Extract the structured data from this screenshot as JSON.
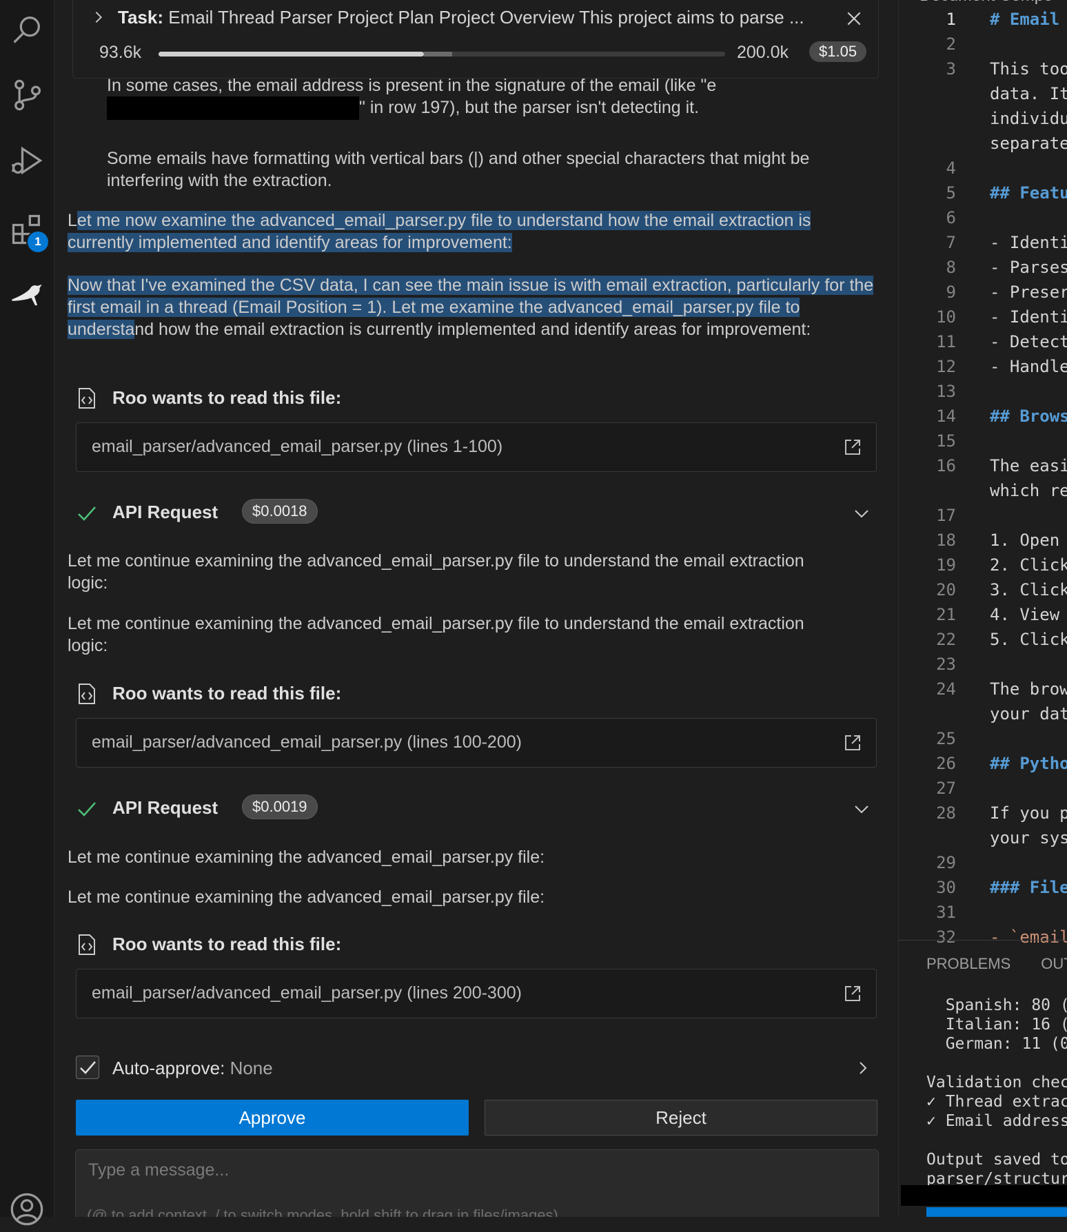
{
  "task": {
    "label": "Task:",
    "title": "Email Thread Parser Project Plan Project Overview This project aims to parse ...",
    "tokens_used": "93.6k",
    "tokens_max": "200.0k",
    "cost": "$1.05",
    "context_fraction": 0.468,
    "context_cached_fraction": 0.05
  },
  "activity": {
    "extensions_badge": "1"
  },
  "messages": {
    "p1_line1": "In some cases, the email address is present in the signature of the email (like \"e",
    "p1_line2": "\" in row 197), but the parser isn't detecting it.",
    "p2": "Some emails have formatting with vertical bars (|) and other special characters that might be interfering with the extraction.",
    "p3a": "L",
    "p3b": "et me now examine the advanced_email_parser.py file to understand how the email extraction is currently implemented and identify areas for improvement:",
    "p4a": "Now that I've examined the CSV data, I can see the main issue is with email extraction, particularly for the first email in a thread (Email Position = 1). Let me examine the advanced_email_parser.py file to understa",
    "p4b": "nd how the email extraction is currently implemented and identify areas for improvement:",
    "read_label_1": "Roo wants to read this file:",
    "file_1": "email_parser/advanced_email_parser.py (lines 1-100)",
    "api_label_1": "API Request",
    "api_cost_1": "$0.0018",
    "p5": "Let me continue examining the advanced_email_parser.py file to understand the email extraction logic:",
    "p6": "Let me continue examining the advanced_email_parser.py file to understand the email extraction logic:",
    "read_label_2": "Roo wants to read this file:",
    "file_2": "email_parser/advanced_email_parser.py (lines 100-200)",
    "api_label_2": "API Request",
    "api_cost_2": "$0.0019",
    "p7": "Let me continue examining the advanced_email_parser.py file:",
    "p8": "Let me continue examining the advanced_email_parser.py file:",
    "read_label_3": "Roo wants to read this file:",
    "file_3": "email_parser/advanced_email_parser.py (lines 200-300)"
  },
  "auto_approve": {
    "label": "Auto-approve:",
    "value": "None"
  },
  "buttons": {
    "approve": "Approve",
    "reject": "Reject"
  },
  "input": {
    "placeholder": "Type a message...",
    "hint": "(@ to add context, / to switch modes, hold shift to drag in files/images)"
  },
  "editor": {
    "top_text": "Document Compo",
    "lines": [
      {
        "n": "1",
        "text": "# Email",
        "kind": "head"
      },
      {
        "n": "2",
        "text": "",
        "kind": "text"
      },
      {
        "n": "3",
        "text": "This too",
        "kind": "text"
      },
      {
        "n": "",
        "text": "data. It",
        "kind": "text"
      },
      {
        "n": "",
        "text": "individu",
        "kind": "text"
      },
      {
        "n": "",
        "text": "separate",
        "kind": "text"
      },
      {
        "n": "4",
        "text": "",
        "kind": "text"
      },
      {
        "n": "5",
        "text": "## Featu",
        "kind": "head"
      },
      {
        "n": "6",
        "text": "",
        "kind": "text"
      },
      {
        "n": "7",
        "text": "- Identi",
        "kind": "list"
      },
      {
        "n": "8",
        "text": "- Parses",
        "kind": "list"
      },
      {
        "n": "9",
        "text": "- Preser",
        "kind": "list"
      },
      {
        "n": "10",
        "text": "- Identi",
        "kind": "list"
      },
      {
        "n": "11",
        "text": "- Detect",
        "kind": "list"
      },
      {
        "n": "12",
        "text": "- Handle",
        "kind": "list"
      },
      {
        "n": "13",
        "text": "",
        "kind": "text"
      },
      {
        "n": "14",
        "text": "## Brows",
        "kind": "head"
      },
      {
        "n": "15",
        "text": "",
        "kind": "text"
      },
      {
        "n": "16",
        "text": "The easi",
        "kind": "text"
      },
      {
        "n": "",
        "text": "which re",
        "kind": "text"
      },
      {
        "n": "17",
        "text": "",
        "kind": "text"
      },
      {
        "n": "18",
        "text": "1. Open",
        "kind": "list"
      },
      {
        "n": "19",
        "text": "2. Click",
        "kind": "list"
      },
      {
        "n": "20",
        "text": "3. Click",
        "kind": "list"
      },
      {
        "n": "21",
        "text": "4. View",
        "kind": "list"
      },
      {
        "n": "22",
        "text": "5. Click",
        "kind": "list"
      },
      {
        "n": "23",
        "text": "",
        "kind": "text"
      },
      {
        "n": "24",
        "text": "The brow",
        "kind": "text"
      },
      {
        "n": "",
        "text": "your dat",
        "kind": "text"
      },
      {
        "n": "25",
        "text": "",
        "kind": "text"
      },
      {
        "n": "26",
        "text": "## Pytho",
        "kind": "head"
      },
      {
        "n": "27",
        "text": "",
        "kind": "text"
      },
      {
        "n": "28",
        "text": "If you p",
        "kind": "text"
      },
      {
        "n": "",
        "text": "your sys",
        "kind": "text"
      },
      {
        "n": "29",
        "text": "",
        "kind": "text"
      },
      {
        "n": "30",
        "text": "### File",
        "kind": "head"
      },
      {
        "n": "31",
        "text": "",
        "kind": "text"
      },
      {
        "n": "32",
        "text": "- `email",
        "kind": "str"
      }
    ],
    "panel_tabs": [
      "PROBLEMS",
      "OUT"
    ],
    "terminal": [
      "  Spanish: 80 (",
      "  Italian: 16 (",
      "  German: 11 (0",
      "",
      "Validation chec",
      "✓ Thread extrac",
      "✓ Email address",
      "",
      "Output saved to",
      "parser/structur"
    ]
  }
}
